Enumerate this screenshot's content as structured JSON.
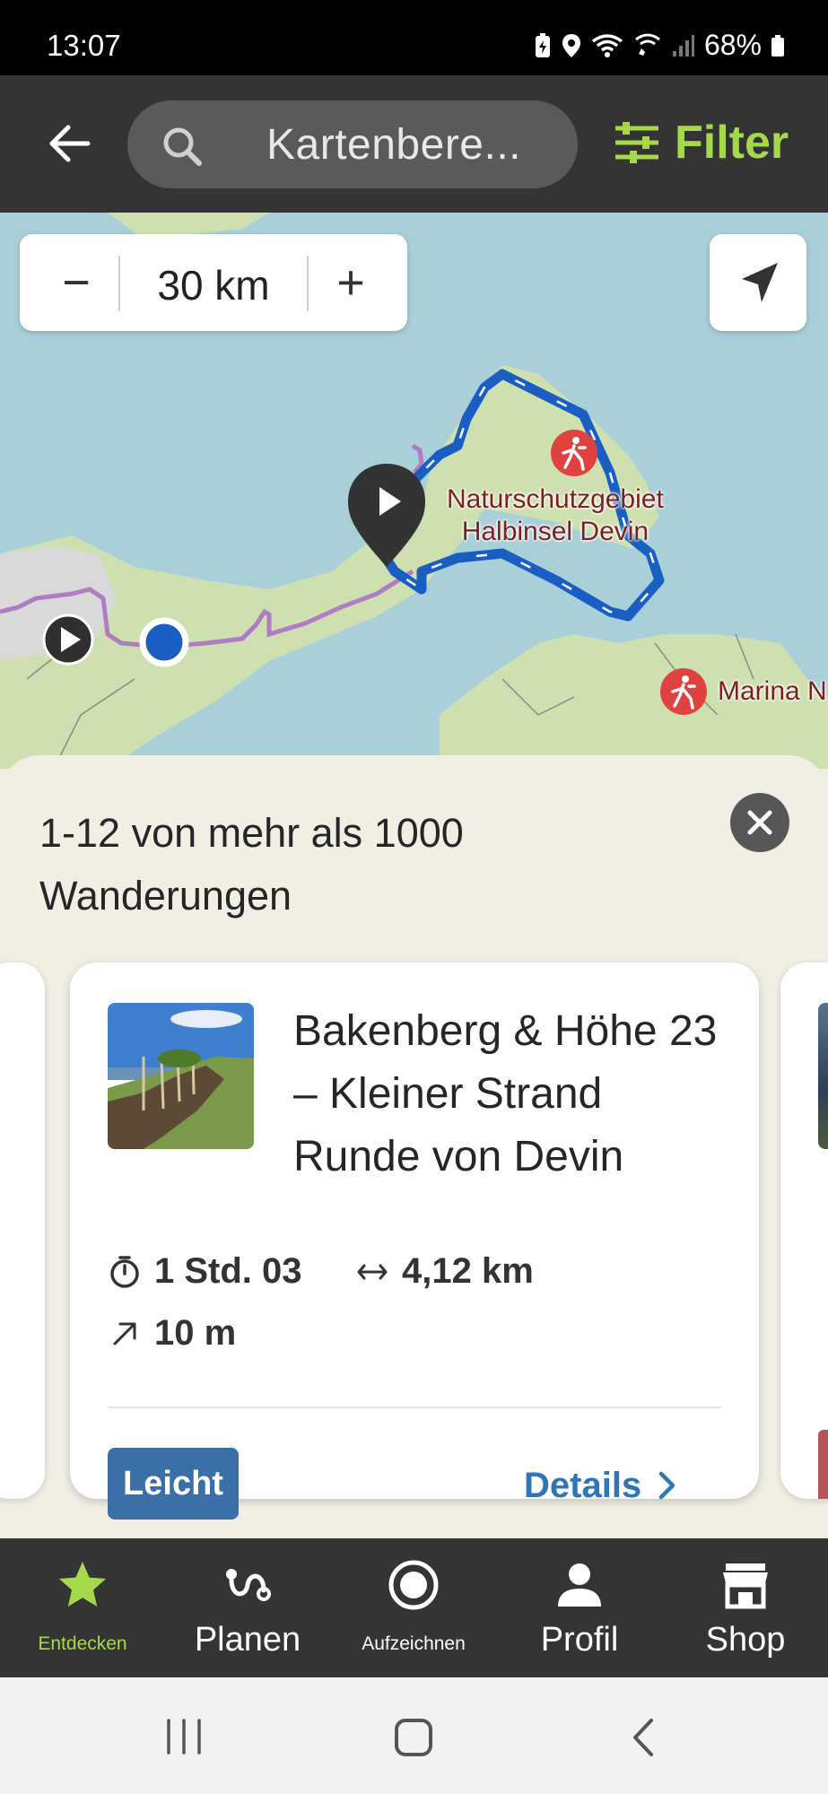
{
  "status_bar": {
    "time": "13:07",
    "battery": "68%"
  },
  "top_bar": {
    "search_placeholder": "Kartenbere...",
    "filter_label": "Filter"
  },
  "map": {
    "zoom_radius": "30 km",
    "poi_label_1": "Naturschutzgebiet\nHalbinsel Devin",
    "poi_label_2": "Marina N",
    "colors": {
      "water": "#a9cfd8",
      "land": "#cfe0b0",
      "route": "#1a5ec4",
      "trail": "#b07cc4",
      "poi": "#e0433f"
    }
  },
  "results": {
    "count_text": "1-12 von mehr als 1000 Wanderungen",
    "card": {
      "title": "Bakenberg & Höhe 23 – Kleiner Strand Runde von Devin",
      "duration": "1 Std. 03",
      "distance": "4,12 km",
      "elevation": "10 m",
      "difficulty": "Leicht",
      "details_label": "Details",
      "difficulty_color": "#3a6fa8"
    }
  },
  "bottom_nav": {
    "items": [
      {
        "label": "Entdecken",
        "icon": "star-icon",
        "active": true
      },
      {
        "label": "Planen",
        "icon": "route-icon",
        "active": false
      },
      {
        "label": "Aufzeichnen",
        "icon": "record-icon",
        "active": false
      },
      {
        "label": "Profil",
        "icon": "person-icon",
        "active": false
      },
      {
        "label": "Shop",
        "icon": "shop-icon",
        "active": false
      }
    ],
    "active_color": "#a6d94a"
  }
}
